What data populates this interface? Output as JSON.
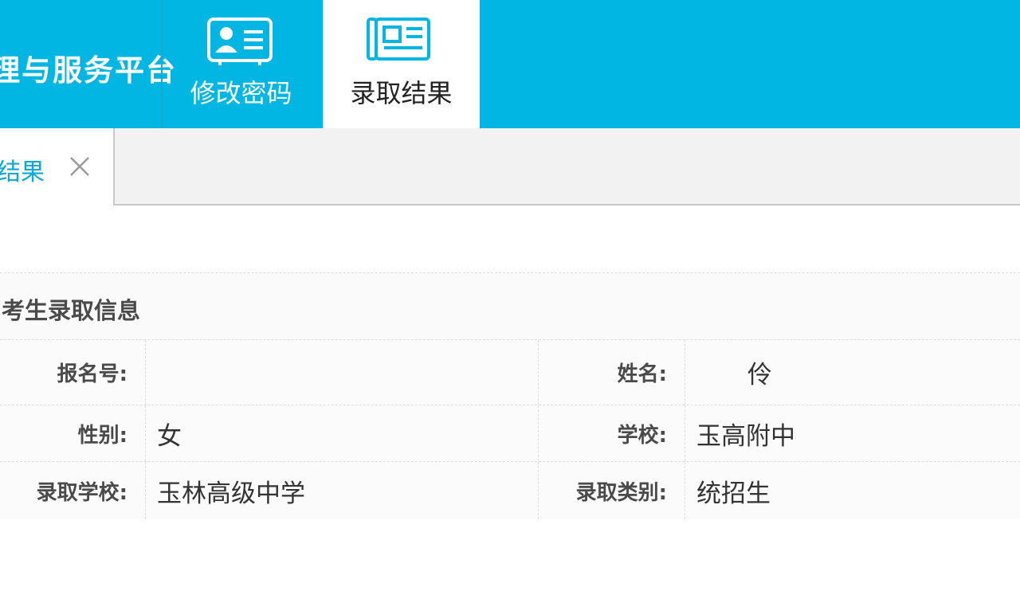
{
  "header": {
    "brand": "理与服务平台",
    "nav": [
      {
        "label": "修改密码",
        "icon": "id-card-icon"
      },
      {
        "label": "录取结果",
        "icon": "newspaper-icon"
      }
    ]
  },
  "tabs": {
    "active_label": "取结果",
    "close_icon": "close-icon"
  },
  "panel": {
    "title": "考生录取信息",
    "rows": [
      {
        "label_left": "报名号:",
        "value_left": "",
        "label_right": "姓名:",
        "value_right": "伶"
      },
      {
        "label_left": "性别:",
        "value_left": "女",
        "label_right": "学校:",
        "value_right": "玉高附中"
      },
      {
        "label_left": "录取学校:",
        "value_left": "玉林高级中学",
        "label_right": "录取类别:",
        "value_right": "统招生"
      }
    ]
  },
  "colors": {
    "header_bg": "#02b6e3",
    "active_tab_text": "#0aa8d6",
    "label_text": "#4a4a4a"
  }
}
